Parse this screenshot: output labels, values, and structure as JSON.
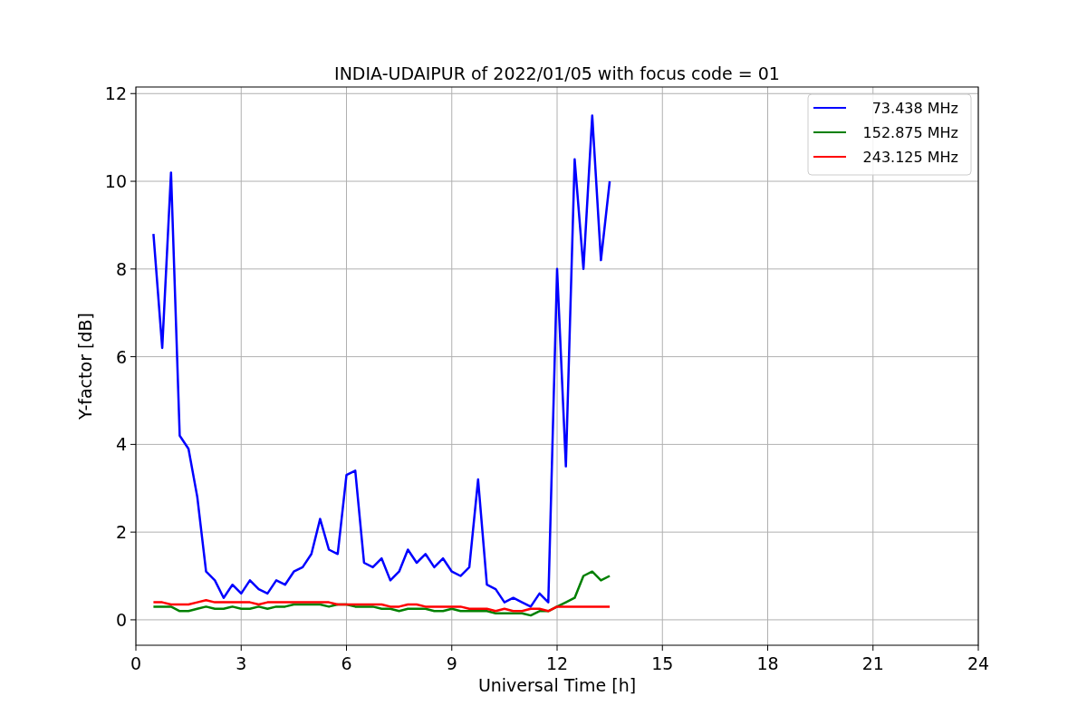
{
  "figure": {
    "chart_data": {
      "type": "line",
      "title": "INDIA-UDAIPUR of 2022/01/05 with focus code = 01",
      "xlabel": "Universal Time [h]",
      "ylabel": "Y-factor [dB]",
      "x": [
        0.5,
        0.75,
        1.0,
        1.25,
        1.5,
        1.75,
        2.0,
        2.25,
        2.5,
        2.75,
        3.0,
        3.25,
        3.5,
        3.75,
        4.0,
        4.25,
        4.5,
        4.75,
        5.0,
        5.25,
        5.5,
        5.75,
        6.0,
        6.25,
        6.5,
        6.75,
        7.0,
        7.25,
        7.5,
        7.75,
        8.0,
        8.25,
        8.5,
        8.75,
        9.0,
        9.25,
        9.5,
        9.75,
        10.0,
        10.25,
        10.5,
        10.75,
        11.0,
        11.25,
        11.5,
        11.75,
        12.0,
        12.25,
        12.5,
        12.75,
        13.0,
        13.25,
        13.5
      ],
      "series": [
        {
          "name": "73.438 MHz",
          "color": "#0000ff",
          "values": [
            8.8,
            6.2,
            10.2,
            4.2,
            3.9,
            2.8,
            1.1,
            0.9,
            0.5,
            0.8,
            0.6,
            0.9,
            0.7,
            0.6,
            0.9,
            0.8,
            1.1,
            1.2,
            1.5,
            2.3,
            1.6,
            1.5,
            3.3,
            3.4,
            1.3,
            1.2,
            1.4,
            0.9,
            1.1,
            1.6,
            1.3,
            1.5,
            1.2,
            1.4,
            1.1,
            1.0,
            1.2,
            3.2,
            0.8,
            0.7,
            0.4,
            0.5,
            0.4,
            0.3,
            0.6,
            0.4,
            8.0,
            3.5,
            10.5,
            8.0,
            11.5,
            8.2,
            10.0
          ]
        },
        {
          "name": "152.875 MHz",
          "color": "#008000",
          "values": [
            0.3,
            0.3,
            0.3,
            0.2,
            0.2,
            0.25,
            0.3,
            0.25,
            0.25,
            0.3,
            0.25,
            0.25,
            0.3,
            0.25,
            0.3,
            0.3,
            0.35,
            0.35,
            0.35,
            0.35,
            0.3,
            0.35,
            0.35,
            0.3,
            0.3,
            0.3,
            0.25,
            0.25,
            0.2,
            0.25,
            0.25,
            0.25,
            0.2,
            0.2,
            0.25,
            0.2,
            0.2,
            0.2,
            0.2,
            0.15,
            0.15,
            0.15,
            0.15,
            0.1,
            0.2,
            0.2,
            0.3,
            0.4,
            0.5,
            1.0,
            1.1,
            0.9,
            1.0
          ]
        },
        {
          "name": "243.125 MHz",
          "color": "#ff0000",
          "values": [
            0.4,
            0.4,
            0.35,
            0.35,
            0.35,
            0.4,
            0.45,
            0.4,
            0.4,
            0.4,
            0.4,
            0.4,
            0.35,
            0.4,
            0.4,
            0.4,
            0.4,
            0.4,
            0.4,
            0.4,
            0.4,
            0.35,
            0.35,
            0.35,
            0.35,
            0.35,
            0.35,
            0.3,
            0.3,
            0.35,
            0.35,
            0.3,
            0.3,
            0.3,
            0.3,
            0.3,
            0.25,
            0.25,
            0.25,
            0.2,
            0.25,
            0.2,
            0.2,
            0.25,
            0.25,
            0.2,
            0.3,
            0.3,
            0.3,
            0.3,
            0.3,
            0.3,
            0.3
          ]
        }
      ],
      "xlim": [
        0,
        24
      ],
      "ylim": [
        -0.58,
        12.15
      ],
      "xticks": [
        0,
        3,
        6,
        9,
        12,
        15,
        18,
        21,
        24
      ],
      "yticks": [
        0,
        2,
        4,
        6,
        8,
        10,
        12
      ],
      "grid": true,
      "legend": true
    }
  }
}
